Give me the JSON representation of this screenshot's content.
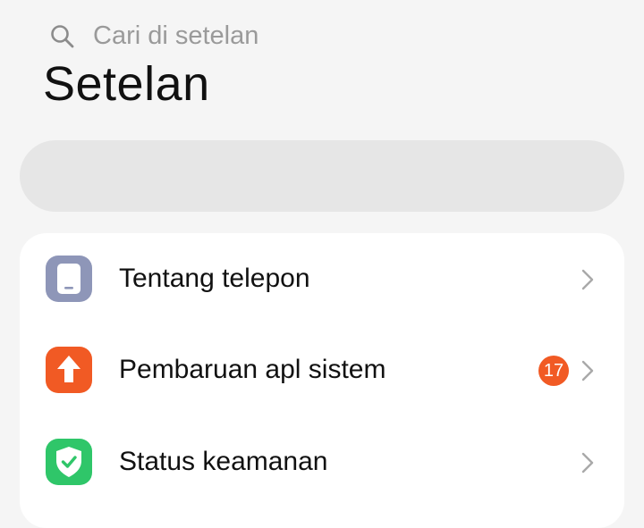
{
  "header": {
    "title": "Setelan"
  },
  "search": {
    "placeholder": "Cari di setelan",
    "icon": "search-icon"
  },
  "settings": {
    "items": [
      {
        "label": "Tentang telepon",
        "icon": "phone-icon",
        "icon_color": "#8e96b8"
      },
      {
        "label": "Pembaruan apl sistem",
        "icon": "arrow-up-icon",
        "icon_color": "#f15a24",
        "badge": "17",
        "badge_color": "#f15a24"
      },
      {
        "label": "Status keamanan",
        "icon": "shield-check-icon",
        "icon_color": "#2fc669"
      }
    ]
  }
}
